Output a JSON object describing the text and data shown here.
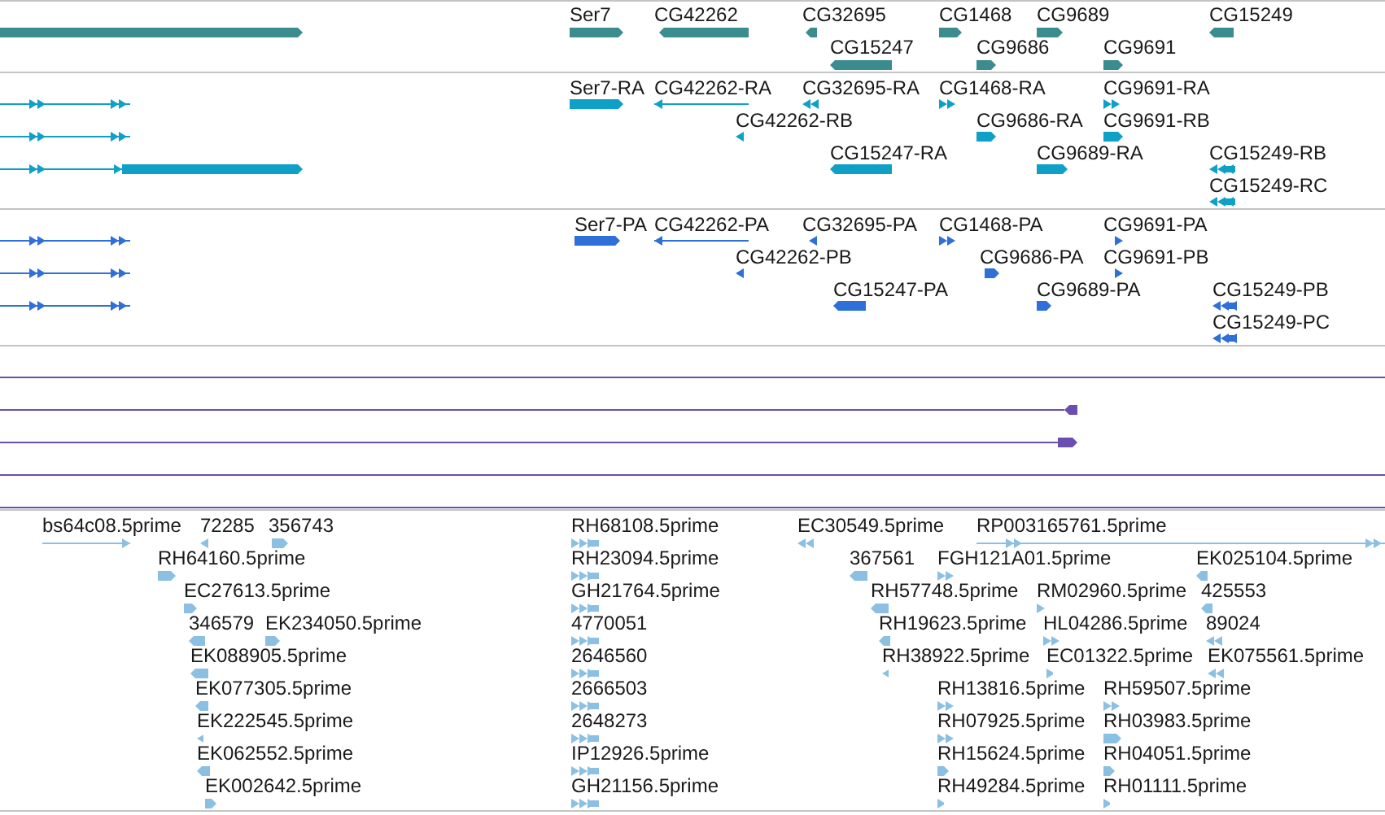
{
  "tracks": [
    {
      "kind": "features",
      "color": "#3a8c8f",
      "features": [
        {
          "reverse": false
        },
        {
          "label": "Ser7",
          "reverse": false
        },
        {
          "label": "CG42262",
          "reverse": true
        },
        {
          "label": "CG32695",
          "reverse": true
        },
        {
          "label": "CG1468",
          "reverse": false
        },
        {
          "label": "CG9689",
          "reverse": false
        },
        {
          "label": "CG15249",
          "reverse": true
        },
        {
          "label": "CG15247",
          "reverse": true
        },
        {
          "label": "CG9686",
          "reverse": false
        },
        {
          "label": "CG9691",
          "reverse": false
        }
      ]
    },
    {
      "kind": "features",
      "color": "#0ea0c6",
      "features": [
        {
          "reverse": false
        },
        {
          "reverse": false
        },
        {
          "reverse": false
        },
        {
          "label": "Ser7-RA",
          "reverse": false
        },
        {
          "label": "CG42262-RA",
          "reverse": true
        },
        {
          "label": "CG32695-RA",
          "reverse": true
        },
        {
          "label": "CG1468-RA",
          "reverse": false
        },
        {
          "label": "CG9691-RA",
          "reverse": false
        },
        {
          "label": "CG42262-RB",
          "reverse": true
        },
        {
          "label": "CG9686-RA",
          "reverse": false
        },
        {
          "label": "CG9691-RB",
          "reverse": false
        },
        {
          "label": "CG15247-RA",
          "reverse": true
        },
        {
          "label": "CG9689-RA",
          "reverse": false
        },
        {
          "label": "CG15249-RB",
          "reverse": true
        },
        {
          "label": "CG15249-RC",
          "reverse": true
        }
      ]
    },
    {
      "kind": "features",
      "color": "#2e6fd8",
      "features": [
        {
          "reverse": false
        },
        {
          "reverse": false
        },
        {
          "reverse": false
        },
        {
          "label": "Ser7-PA",
          "reverse": false
        },
        {
          "label": "CG42262-PA",
          "reverse": true
        },
        {
          "label": "CG32695-PA",
          "reverse": true
        },
        {
          "label": "CG1468-PA",
          "reverse": false
        },
        {
          "label": "CG9691-PA",
          "reverse": false
        },
        {
          "label": "CG42262-PB",
          "reverse": true
        },
        {
          "label": "CG9686-PA",
          "reverse": false
        },
        {
          "label": "CG9691-PB",
          "reverse": false
        },
        {
          "label": "CG15247-PA",
          "reverse": true
        },
        {
          "label": "CG9689-PA",
          "reverse": false
        },
        {
          "label": "CG15249-PB",
          "reverse": true
        },
        {
          "label": "CG15249-PC",
          "reverse": true
        }
      ]
    },
    {
      "kind": "alignments",
      "color": "#6a4fb0",
      "lines": [
        {
          "kind": "open"
        },
        {
          "kind": "reverse"
        },
        {
          "kind": "forward"
        },
        {
          "kind": "open"
        },
        {
          "kind": "open"
        }
      ]
    },
    {
      "kind": "features",
      "color": "#8cc0e3",
      "features": [
        {
          "label": "bs64c08.5prime",
          "reverse": false
        },
        {
          "label": "72285",
          "reverse": true
        },
        {
          "label": "356743",
          "reverse": false
        },
        {
          "label": "RH68108.5prime",
          "reverse": false
        },
        {
          "label": "EC30549.5prime",
          "reverse": true
        },
        {
          "label": "RP003165761.5prime",
          "reverse": false
        },
        {
          "label": "RH64160.5prime",
          "reverse": false
        },
        {
          "label": "RH23094.5prime",
          "reverse": false
        },
        {
          "label": "367561",
          "reverse": true
        },
        {
          "label": "FGH121A01.5prime",
          "reverse": false
        },
        {
          "label": "EK025104.5prime",
          "reverse": true
        },
        {
          "label": "EC27613.5prime",
          "reverse": false
        },
        {
          "label": "GH21764.5prime",
          "reverse": false
        },
        {
          "label": "RH57748.5prime",
          "reverse": true
        },
        {
          "label": "RM02960.5prime",
          "reverse": false
        },
        {
          "label": "425553",
          "reverse": true
        },
        {
          "label": "346579",
          "reverse": true
        },
        {
          "label": "EK234050.5prime",
          "reverse": false
        },
        {
          "label": "4770051",
          "reverse": false
        },
        {
          "label": "RH19623.5prime",
          "reverse": true
        },
        {
          "label": "HL04286.5prime",
          "reverse": false
        },
        {
          "label": "89024",
          "reverse": true
        },
        {
          "label": "EK088905.5prime",
          "reverse": true
        },
        {
          "label": "2646560",
          "reverse": false
        },
        {
          "label": "RH38922.5prime",
          "reverse": true
        },
        {
          "label": "EC01322.5prime",
          "reverse": false
        },
        {
          "label": "EK075561.5prime",
          "reverse": true
        },
        {
          "label": "EK077305.5prime",
          "reverse": true
        },
        {
          "label": "2666503",
          "reverse": false
        },
        {
          "label": "RH13816.5prime",
          "reverse": false
        },
        {
          "label": "RH59507.5prime",
          "reverse": false
        },
        {
          "label": "EK222545.5prime",
          "reverse": true
        },
        {
          "label": "2648273",
          "reverse": false
        },
        {
          "label": "RH07925.5prime",
          "reverse": false
        },
        {
          "label": "RH03983.5prime",
          "reverse": false
        },
        {
          "label": "EK062552.5prime",
          "reverse": true
        },
        {
          "label": "IP12926.5prime",
          "reverse": false
        },
        {
          "label": "RH15624.5prime",
          "reverse": false
        },
        {
          "label": "RH04051.5prime",
          "reverse": false
        },
        {
          "label": "EK002642.5prime",
          "reverse": false
        },
        {
          "label": "GH21156.5prime",
          "reverse": false
        },
        {
          "label": "RH49284.5prime",
          "reverse": false
        },
        {
          "label": "RH01111.5prime",
          "reverse": false
        }
      ]
    }
  ]
}
